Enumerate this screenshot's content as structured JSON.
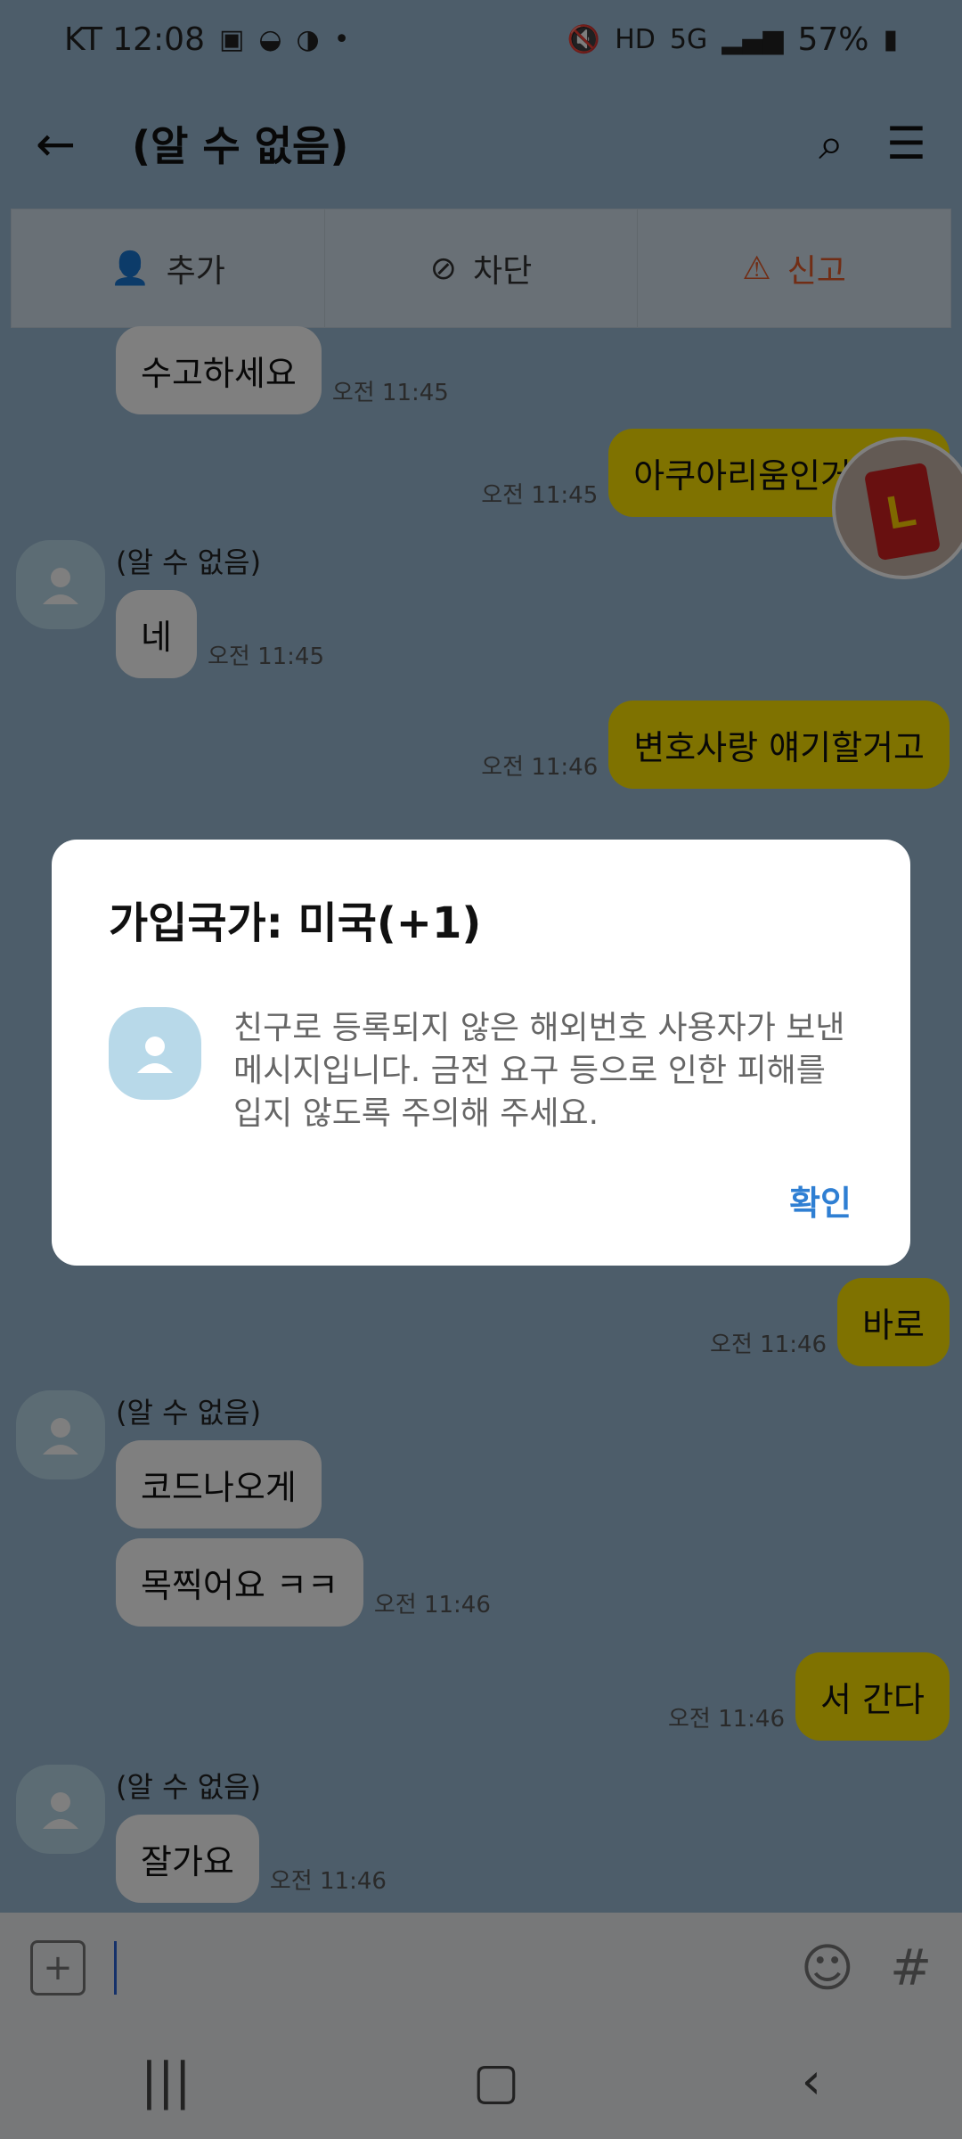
{
  "status": {
    "carrier_time": "KT 12:08",
    "battery": "57%"
  },
  "app_bar": {
    "title": "(알 수 없음)",
    "back_icon": "arrow-left-icon",
    "search_icon": "search-icon",
    "menu_icon": "hamburger-menu-icon"
  },
  "actions": [
    {
      "label": "추가",
      "icon": "add-friend-icon"
    },
    {
      "label": "차단",
      "icon": "block-icon"
    },
    {
      "label": "신고",
      "icon": "siren-report-icon"
    }
  ],
  "chat": {
    "sender_name": "(알 수 없음)",
    "messages": [
      {
        "text": "수고하세요",
        "time": "오전 11:45"
      },
      {
        "text": "아쿠아리움인거 확인",
        "time": "오전 11:45"
      },
      {
        "text": "네",
        "time": "오전 11:45"
      },
      {
        "text": "변호사랑 얘기할거고",
        "time": "오전 11:46"
      },
      {
        "text": "바로",
        "time": "오전 11:46"
      },
      {
        "text": "코드나오게",
        "time": ""
      },
      {
        "text": "목찍어요 ㅋㅋ",
        "time": "오전 11:46"
      },
      {
        "text": "서 간다",
        "time": "오전 11:46"
      },
      {
        "text": "잘가요",
        "time": "오전 11:46"
      }
    ]
  },
  "dialog": {
    "title": "가입국가: 미국(+1)",
    "text": "친구로 등록되지 않은 해외번호 사용자가 보낸 메시지입니다. 금전 요구 등으로 인한 피해를 입지 않도록 주의해 주세요.",
    "confirm_label": "확인"
  },
  "input": {
    "plus_icon": "plus-icon",
    "emoji_icon": "emoji-icon",
    "hash_icon": "hashtag-icon"
  },
  "nav": {
    "recent_icon": "recent-apps-icon",
    "home_icon": "home-icon",
    "back_icon": "nav-back-icon"
  }
}
